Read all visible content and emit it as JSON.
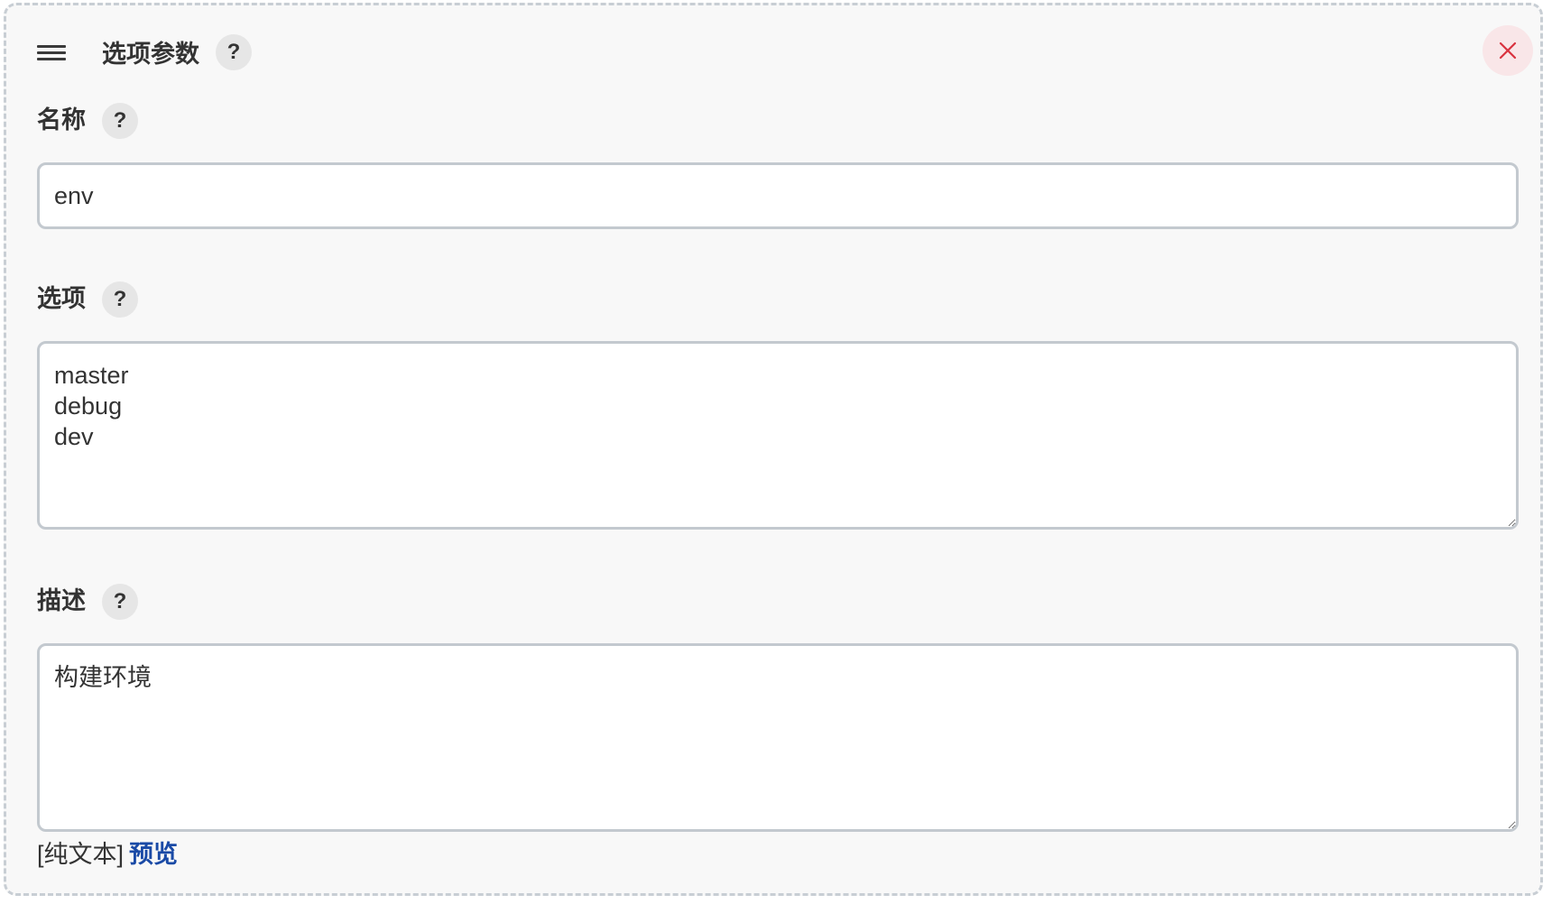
{
  "header": {
    "title": "选项参数",
    "help_label": "?",
    "drag_icon": "hamburger-icon",
    "close_icon": "close-icon",
    "close_color": "#d9323f"
  },
  "fields": {
    "name": {
      "label": "名称",
      "help_label": "?",
      "value": "env"
    },
    "choices": {
      "label": "选项",
      "help_label": "?",
      "value": "master\ndebug\ndev"
    },
    "description": {
      "label": "描述",
      "help_label": "?",
      "value": "构建环境"
    }
  },
  "footer": {
    "format_label": "[纯文本]",
    "preview_link": "预览",
    "link_color": "#1a4aa6"
  }
}
